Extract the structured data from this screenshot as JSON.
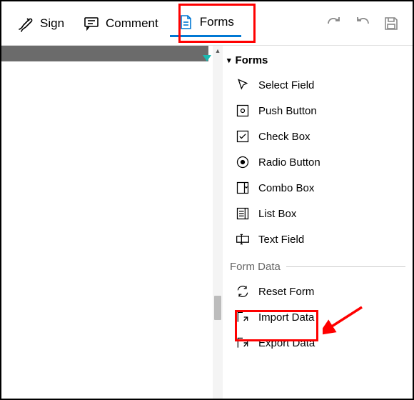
{
  "toolbar": {
    "sign_label": "Sign",
    "comment_label": "Comment",
    "forms_label": "Forms"
  },
  "panel": {
    "title": "Forms",
    "items": [
      {
        "label": "Select Field"
      },
      {
        "label": "Push Button"
      },
      {
        "label": "Check Box"
      },
      {
        "label": "Radio Button"
      },
      {
        "label": "Combo Box"
      },
      {
        "label": "List Box"
      },
      {
        "label": "Text Field"
      }
    ],
    "form_data_label": "Form Data",
    "data_items": [
      {
        "label": "Reset Form"
      },
      {
        "label": "Import Data"
      },
      {
        "label": "Export Data"
      }
    ]
  }
}
